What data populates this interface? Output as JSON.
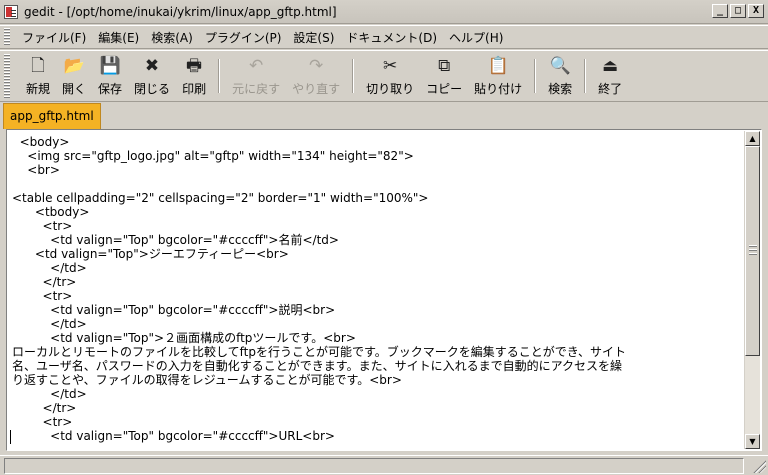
{
  "window": {
    "title": "gedit - [/opt/home/inukai/ykrim/linux/app_gftp.html]",
    "controls": {
      "minimize": "_",
      "maximize": "□",
      "close": "X"
    }
  },
  "menubar": {
    "items": [
      {
        "label": "ファイル(F)"
      },
      {
        "label": "編集(E)"
      },
      {
        "label": "検索(A)"
      },
      {
        "label": "プラグイン(P)"
      },
      {
        "label": "設定(S)"
      },
      {
        "label": "ドキュメント(D)"
      },
      {
        "label": "ヘルプ(H)"
      }
    ]
  },
  "toolbar": {
    "buttons": [
      {
        "label": "新規",
        "icon": "new-document-icon",
        "glyph": "🗋"
      },
      {
        "label": "開く",
        "icon": "open-folder-icon",
        "glyph": "📂"
      },
      {
        "label": "保存",
        "icon": "save-disk-icon",
        "glyph": "💾"
      },
      {
        "label": "閉じる",
        "icon": "close-x-icon",
        "glyph": "✖"
      },
      {
        "label": "印刷",
        "icon": "printer-icon",
        "glyph": "🖶"
      },
      {
        "label": "元に戻す",
        "icon": "undo-arrow-icon",
        "glyph": "↶"
      },
      {
        "label": "やり直す",
        "icon": "redo-arrow-icon",
        "glyph": "↷"
      },
      {
        "label": "切り取り",
        "icon": "scissors-icon",
        "glyph": "✂"
      },
      {
        "label": "コピー",
        "icon": "copy-icon",
        "glyph": "⧉"
      },
      {
        "label": "貼り付け",
        "icon": "paste-clipboard-icon",
        "glyph": "📋"
      },
      {
        "label": "検索",
        "icon": "magnifier-icon",
        "glyph": "🔍"
      },
      {
        "label": "終了",
        "icon": "exit-door-icon",
        "glyph": "⏏"
      }
    ]
  },
  "tabs": [
    {
      "label": "app_gftp.html"
    }
  ],
  "editor": {
    "lines": [
      "  <body>",
      "    <img src=\"gftp_logo.jpg\" alt=\"gftp\" width=\"134\" height=\"82\">",
      "    <br>",
      "",
      "<table cellpadding=\"2\" cellspacing=\"2\" border=\"1\" width=\"100%\">",
      "      <tbody>",
      "        <tr>",
      "          <td valign=\"Top\" bgcolor=\"#ccccff\">名前</td>",
      "      <td valign=\"Top\">ジーエフティーピー<br>",
      "          </td>",
      "        </tr>",
      "        <tr>",
      "          <td valign=\"Top\" bgcolor=\"#ccccff\">説明<br>",
      "          </td>",
      "          <td valign=\"Top\">２画面構成のftpツールです。<br>",
      "ローカルとリモートのファイルを比較してftpを行うことが可能です。ブックマークを編集することができ、サイト",
      "名、ユーザ名、パスワードの入力を自動化することができます。また、サイトに入れるまで自動的にアクセスを繰",
      "り返すことや、ファイルの取得をレジュームすることが可能です。<br>",
      "          </td>",
      "        </tr>",
      "        <tr>",
      "          <td valign=\"Top\" bgcolor=\"#ccccff\">URL<br>"
    ]
  },
  "colors": {
    "tab_active": "#f4b224",
    "chrome": "#d4d0c8",
    "editor_bg": "#ffffff"
  }
}
